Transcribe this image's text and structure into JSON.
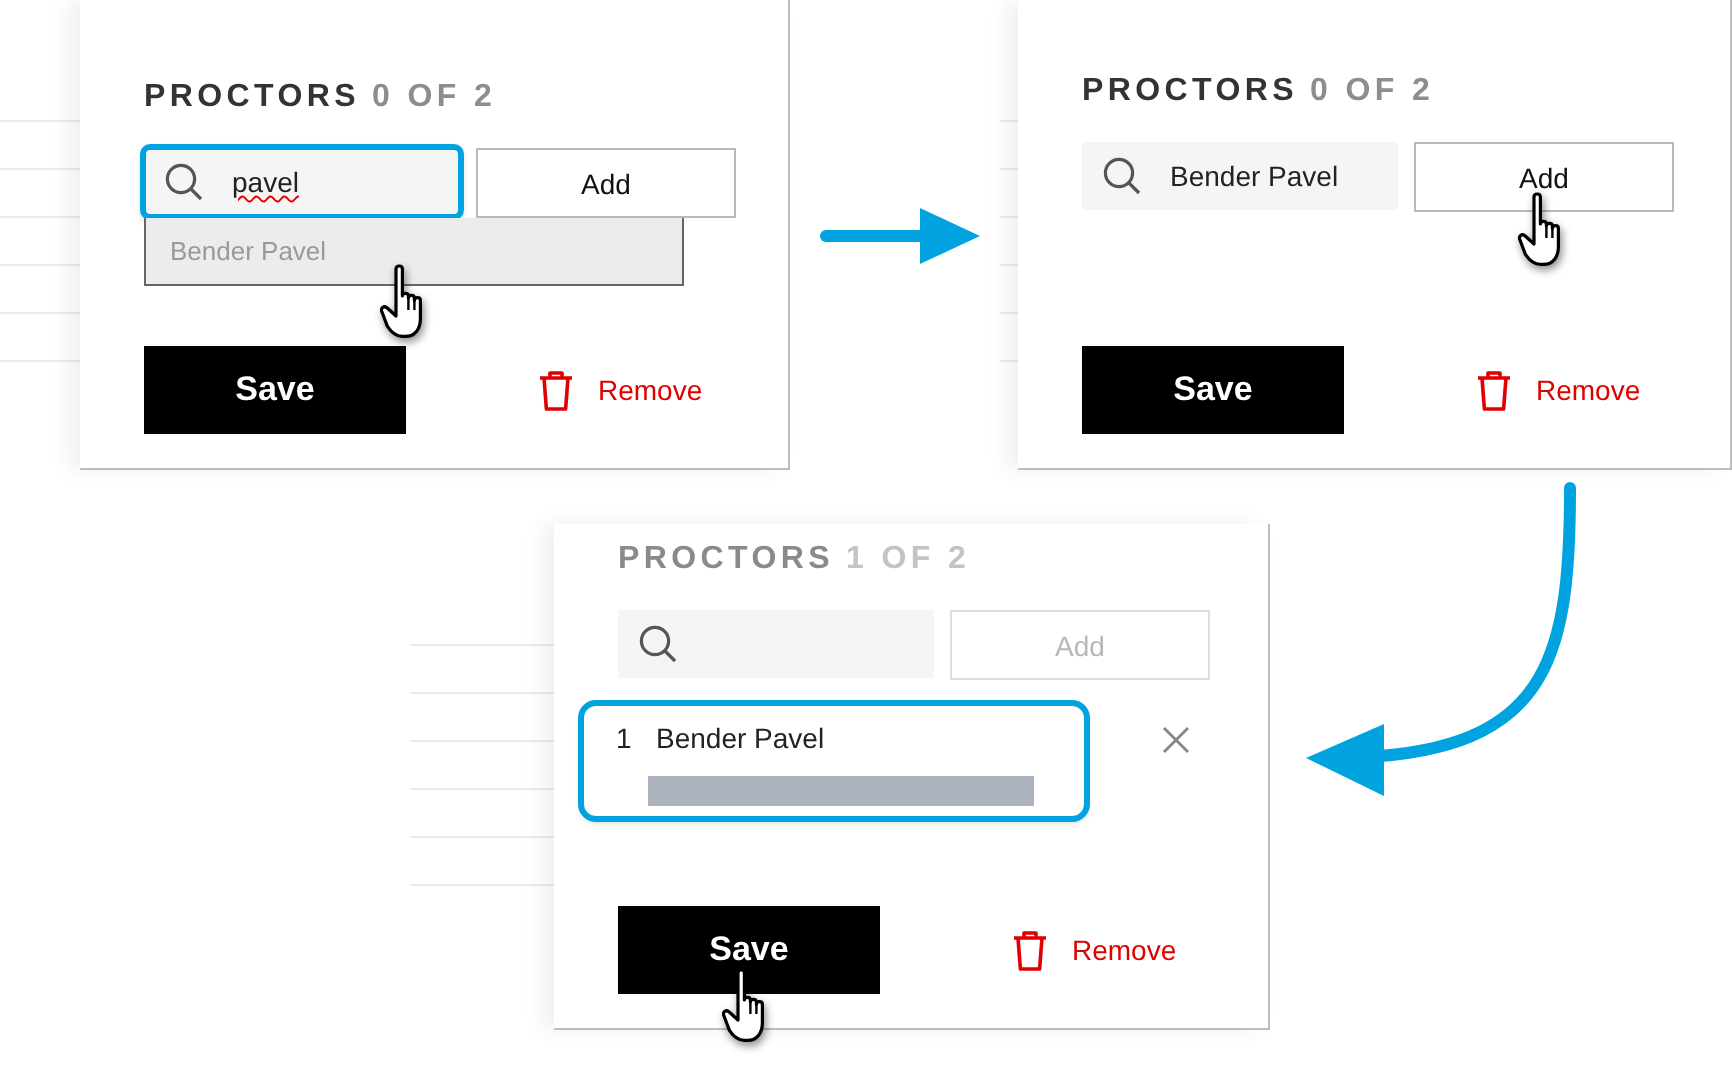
{
  "steps": [
    {
      "heading": "PROCTORS",
      "count": "0 OF 2",
      "heading_disabled": false,
      "search": {
        "value": "pavel",
        "highlighted": true,
        "misspelled": true
      },
      "add_button": {
        "label": "Add",
        "disabled": false,
        "pointer": false
      },
      "suggestions": [
        {
          "label": "Bender Pavel",
          "pointer": true
        }
      ],
      "save_button": {
        "label": "Save",
        "pointer": false
      },
      "remove_button": "Remove"
    },
    {
      "heading": "PROCTORS",
      "count": "0 OF 2",
      "heading_disabled": false,
      "search": {
        "value": "Bender Pavel",
        "highlighted": false
      },
      "add_button": {
        "label": "Add",
        "disabled": false,
        "pointer": true
      },
      "save_button": {
        "label": "Save",
        "pointer": false
      },
      "remove_button": "Remove"
    },
    {
      "heading": "PROCTORS",
      "count": "1 OF 2",
      "heading_disabled": true,
      "search": {
        "highlighted": false
      },
      "add_button": {
        "label": "Add",
        "disabled": true,
        "pointer": false
      },
      "proctors": [
        {
          "number": "1",
          "name": "Bender Pavel",
          "highlighted": true
        }
      ],
      "save_button": {
        "label": "Save",
        "pointer": true
      },
      "remove_button": "Remove"
    }
  ]
}
